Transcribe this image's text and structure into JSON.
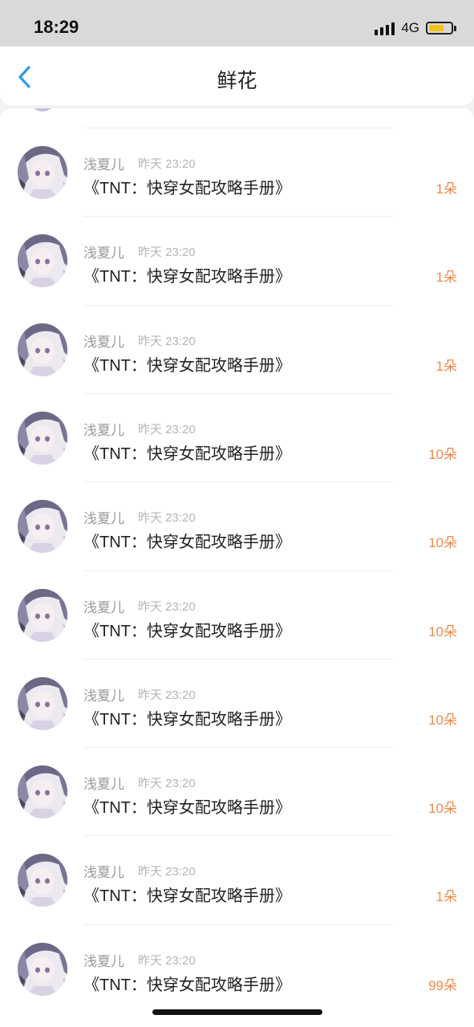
{
  "status": {
    "time": "18:29",
    "network": "4G",
    "battery_color": "#f4c417"
  },
  "nav": {
    "title": "鲜花",
    "back_icon": "chevron-left-icon",
    "accent": "#2e9ae8"
  },
  "gifts": [
    {
      "user": "浅夏儿",
      "time": "昨天 23:20",
      "book": "《TNT：快穿女配攻略手册》",
      "amount": "1朵"
    },
    {
      "user": "浅夏儿",
      "time": "昨天 23:20",
      "book": "《TNT：快穿女配攻略手册》",
      "amount": "1朵"
    },
    {
      "user": "浅夏儿",
      "time": "昨天 23:20",
      "book": "《TNT：快穿女配攻略手册》",
      "amount": "1朵"
    },
    {
      "user": "浅夏儿",
      "time": "昨天 23:20",
      "book": "《TNT：快穿女配攻略手册》",
      "amount": "10朵"
    },
    {
      "user": "浅夏儿",
      "time": "昨天 23:20",
      "book": "《TNT：快穿女配攻略手册》",
      "amount": "10朵"
    },
    {
      "user": "浅夏儿",
      "time": "昨天 23:20",
      "book": "《TNT：快穿女配攻略手册》",
      "amount": "10朵"
    },
    {
      "user": "浅夏儿",
      "time": "昨天 23:20",
      "book": "《TNT：快穿女配攻略手册》",
      "amount": "10朵"
    },
    {
      "user": "浅夏儿",
      "time": "昨天 23:20",
      "book": "《TNT：快穿女配攻略手册》",
      "amount": "10朵"
    },
    {
      "user": "浅夏儿",
      "time": "昨天 23:20",
      "book": "《TNT：快穿女配攻略手册》",
      "amount": "1朵"
    },
    {
      "user": "浅夏儿",
      "time": "昨天 23:20",
      "book": "《TNT：快穿女配攻略手册》",
      "amount": "99朵"
    }
  ],
  "colors": {
    "amount": "#f08a4b",
    "name": "#9a9a9a"
  }
}
